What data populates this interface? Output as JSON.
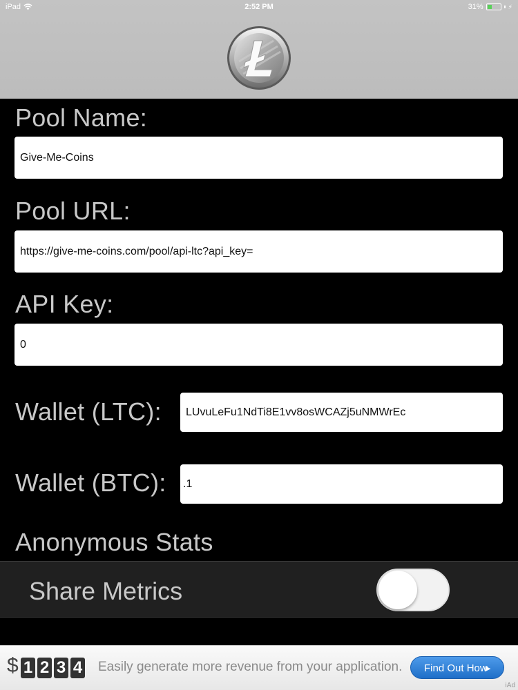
{
  "status_bar": {
    "carrier": "iPad",
    "time": "2:52 PM",
    "battery": "31%",
    "battery_level": 0.31
  },
  "header": {
    "logo_icon": "litecoin-logo-icon"
  },
  "form": {
    "pool_name": {
      "label": "Pool Name:",
      "value": "Give-Me-Coins"
    },
    "pool_url": {
      "label": "Pool URL:",
      "value": "https://give-me-coins.com/pool/api-ltc?api_key="
    },
    "api_key": {
      "label": "API Key:",
      "value": "0"
    },
    "wallet_ltc": {
      "label": "Wallet (LTC):",
      "value": "LUvuLeFu1NdTi8E1vv8osWCAZj5uNMWrEc"
    },
    "wallet_btc": {
      "label": "Wallet (BTC):",
      "value": ".1"
    }
  },
  "anonymous_stats": {
    "heading": "Anonymous Stats",
    "share_metrics_label": "Share Metrics",
    "share_metrics_on": false
  },
  "ad": {
    "dollar": "$",
    "digits": [
      "1",
      "2",
      "3",
      "4"
    ],
    "text": "Easily generate more revenue from your application.",
    "button_label": "Find Out How",
    "badge": "iAd"
  }
}
